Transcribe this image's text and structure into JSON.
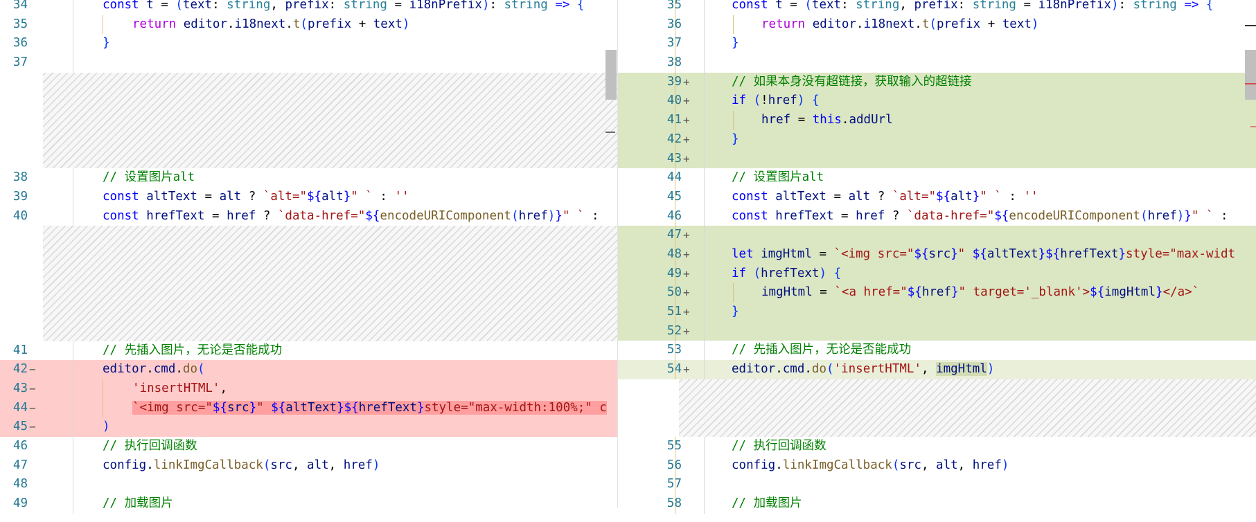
{
  "left": {
    "rows": [
      {
        "kind": "ctx",
        "ln": "34",
        "code": [
          [
            "kw",
            "const "
          ],
          [
            "v",
            "t"
          ],
          [
            "pn",
            " = "
          ],
          [
            "br",
            "("
          ],
          [
            "v",
            "text"
          ],
          [
            "pn",
            ": "
          ],
          [
            "t",
            "string"
          ],
          [
            "pn",
            ", "
          ],
          [
            "v",
            "prefix"
          ],
          [
            "pn",
            ": "
          ],
          [
            "t",
            "string"
          ],
          [
            "pn",
            " = "
          ],
          [
            "v",
            "i18nPrefix"
          ],
          [
            "br",
            ")"
          ],
          [
            "pn",
            ": "
          ],
          [
            "t",
            "string"
          ],
          [
            "pn",
            " "
          ],
          [
            "kw",
            "=>"
          ],
          [
            "pn",
            " "
          ],
          [
            "br",
            "{"
          ]
        ],
        "ind": 0
      },
      {
        "kind": "ctx",
        "ln": "35",
        "code": [
          [
            "kw2",
            "return "
          ],
          [
            "v",
            "editor"
          ],
          [
            "pn",
            "."
          ],
          [
            "v",
            "i18next"
          ],
          [
            "pn",
            "."
          ],
          [
            "fn",
            "t"
          ],
          [
            "br",
            "("
          ],
          [
            "v",
            "prefix"
          ],
          [
            "pn",
            " + "
          ],
          [
            "v",
            "text"
          ],
          [
            "br",
            ")"
          ]
        ],
        "ind": 1
      },
      {
        "kind": "ctx",
        "ln": "36",
        "code": [
          [
            "br",
            "}"
          ]
        ],
        "ind": 0
      },
      {
        "kind": "ctx",
        "ln": "37",
        "code": [],
        "ind": 0
      },
      {
        "kind": "gap",
        "style": "hatch",
        "lines": 5
      },
      {
        "kind": "ctx",
        "ln": "38",
        "code": [
          [
            "cm",
            "// 设置图片alt"
          ]
        ],
        "ind": 0
      },
      {
        "kind": "ctx",
        "ln": "39",
        "code": [
          [
            "kw",
            "const "
          ],
          [
            "v",
            "altText"
          ],
          [
            "pn",
            " = "
          ],
          [
            "v",
            "alt"
          ],
          [
            "pn",
            " ? "
          ],
          [
            "s",
            "`alt=\""
          ],
          [
            "b",
            "${"
          ],
          [
            "v",
            "alt"
          ],
          [
            "b",
            "}"
          ],
          [
            "s",
            "\" `"
          ],
          [
            "pn",
            " : "
          ],
          [
            "s",
            "''"
          ]
        ],
        "ind": 0
      },
      {
        "kind": "ctx",
        "ln": "40",
        "code": [
          [
            "kw",
            "const "
          ],
          [
            "v",
            "hrefText"
          ],
          [
            "pn",
            " = "
          ],
          [
            "v",
            "href"
          ],
          [
            "pn",
            " ? "
          ],
          [
            "s",
            "`data-href=\""
          ],
          [
            "b",
            "${"
          ],
          [
            "fn",
            "encodeURIComponent"
          ],
          [
            "br",
            "("
          ],
          [
            "v",
            "href"
          ],
          [
            "br",
            ")"
          ],
          [
            "b",
            "}"
          ],
          [
            "s",
            "\" `"
          ],
          [
            "pn",
            " :"
          ]
        ],
        "ind": 0
      },
      {
        "kind": "gap",
        "style": "hatch",
        "lines": 6
      },
      {
        "kind": "ctx",
        "ln": "41",
        "code": [
          [
            "cm",
            "// 先插入图片，无论是否能成功"
          ]
        ],
        "ind": 0
      },
      {
        "kind": "del",
        "ln": "42",
        "code": [
          [
            "v",
            "editor"
          ],
          [
            "pn",
            "."
          ],
          [
            "v",
            "cmd"
          ],
          [
            "pn",
            "."
          ],
          [
            "fn",
            "do"
          ],
          [
            "br",
            "("
          ]
        ],
        "ind": 0
      },
      {
        "kind": "del",
        "ln": "43",
        "code": [
          [
            "s",
            "'insertHTML'"
          ],
          [
            "pn",
            ","
          ]
        ],
        "ind": 1
      },
      {
        "kind": "del",
        "ln": "44",
        "code": [
          [
            "s",
            "`<img"
          ],
          [
            "mk",
            ""
          ],
          [
            "s",
            " src=\""
          ],
          [
            "b",
            "${"
          ],
          [
            "v",
            "src"
          ],
          [
            "b",
            "}"
          ],
          [
            "s",
            "\" "
          ],
          [
            "b",
            "${"
          ],
          [
            "v",
            "altText"
          ],
          [
            "b",
            "}${"
          ],
          [
            "v",
            "hrefText"
          ],
          [
            "b",
            "}"
          ],
          [
            "s",
            "style=\"max-width:100%;\" c"
          ]
        ],
        "ind": 1
      },
      {
        "kind": "del",
        "ln": "45",
        "code": [
          [
            "br",
            ")"
          ]
        ],
        "ind": 0
      },
      {
        "kind": "ctx",
        "ln": "46",
        "code": [
          [
            "cm",
            "// 执行回调函数"
          ]
        ],
        "ind": 0
      },
      {
        "kind": "ctx",
        "ln": "47",
        "code": [
          [
            "v",
            "config"
          ],
          [
            "pn",
            "."
          ],
          [
            "fn",
            "linkImgCallback"
          ],
          [
            "br",
            "("
          ],
          [
            "v",
            "src"
          ],
          [
            "pn",
            ", "
          ],
          [
            "v",
            "alt"
          ],
          [
            "pn",
            ", "
          ],
          [
            "v",
            "href"
          ],
          [
            "br",
            ")"
          ]
        ],
        "ind": 0
      },
      {
        "kind": "ctx",
        "ln": "48",
        "code": [],
        "ind": 0
      },
      {
        "kind": "ctx",
        "ln": "49",
        "code": [
          [
            "cm",
            "// 加载图片"
          ]
        ],
        "ind": 0
      }
    ]
  },
  "right": {
    "rows": [
      {
        "kind": "ctx",
        "ln": "35",
        "code": [
          [
            "kw",
            "const "
          ],
          [
            "v",
            "t"
          ],
          [
            "pn",
            " = "
          ],
          [
            "br",
            "("
          ],
          [
            "v",
            "text"
          ],
          [
            "pn",
            ": "
          ],
          [
            "t",
            "string"
          ],
          [
            "pn",
            ", "
          ],
          [
            "v",
            "prefix"
          ],
          [
            "pn",
            ": "
          ],
          [
            "t",
            "string"
          ],
          [
            "pn",
            " = "
          ],
          [
            "v",
            "i18nPrefix"
          ],
          [
            "br",
            ")"
          ],
          [
            "pn",
            ": "
          ],
          [
            "t",
            "string"
          ],
          [
            "pn",
            " "
          ],
          [
            "kw",
            "=>"
          ],
          [
            "pn",
            " "
          ],
          [
            "br",
            "{"
          ]
        ],
        "ind": 0
      },
      {
        "kind": "ctx",
        "ln": "36",
        "code": [
          [
            "kw2",
            "return "
          ],
          [
            "v",
            "editor"
          ],
          [
            "pn",
            "."
          ],
          [
            "v",
            "i18next"
          ],
          [
            "pn",
            "."
          ],
          [
            "fn",
            "t"
          ],
          [
            "br",
            "("
          ],
          [
            "v",
            "prefix"
          ],
          [
            "pn",
            " + "
          ],
          [
            "v",
            "text"
          ],
          [
            "br",
            ")"
          ]
        ],
        "ind": 1
      },
      {
        "kind": "ctx",
        "ln": "37",
        "code": [
          [
            "br",
            "}"
          ]
        ],
        "ind": 0
      },
      {
        "kind": "ctx",
        "ln": "38",
        "code": [],
        "ind": 0
      },
      {
        "kind": "add",
        "ln": "39",
        "code": [
          [
            "cm",
            "// 如果本身没有超链接，获取输入的超链接"
          ]
        ],
        "ind": 0
      },
      {
        "kind": "add",
        "ln": "40",
        "code": [
          [
            "kw",
            "if "
          ],
          [
            "br",
            "("
          ],
          [
            "pn",
            "!"
          ],
          [
            "v",
            "href"
          ],
          [
            "br",
            ")"
          ],
          [
            "pn",
            " "
          ],
          [
            "br",
            "{"
          ]
        ],
        "ind": 0
      },
      {
        "kind": "add",
        "ln": "41",
        "code": [
          [
            "v",
            "href"
          ],
          [
            "pn",
            " = "
          ],
          [
            "kw",
            "this"
          ],
          [
            "pn",
            "."
          ],
          [
            "v",
            "addUrl"
          ]
        ],
        "ind": 1
      },
      {
        "kind": "add",
        "ln": "42",
        "code": [
          [
            "br",
            "}"
          ]
        ],
        "ind": 0
      },
      {
        "kind": "add",
        "ln": "43",
        "code": [],
        "ind": 0
      },
      {
        "kind": "ctx",
        "ln": "44",
        "code": [
          [
            "cm",
            "// 设置图片alt"
          ]
        ],
        "ind": 0
      },
      {
        "kind": "ctx",
        "ln": "45",
        "code": [
          [
            "kw",
            "const "
          ],
          [
            "v",
            "altText"
          ],
          [
            "pn",
            " = "
          ],
          [
            "v",
            "alt"
          ],
          [
            "pn",
            " ? "
          ],
          [
            "s",
            "`alt=\""
          ],
          [
            "b",
            "${"
          ],
          [
            "v",
            "alt"
          ],
          [
            "b",
            "}"
          ],
          [
            "s",
            "\" `"
          ],
          [
            "pn",
            " : "
          ],
          [
            "s",
            "''"
          ]
        ],
        "ind": 0
      },
      {
        "kind": "ctx",
        "ln": "46",
        "code": [
          [
            "kw",
            "const "
          ],
          [
            "v",
            "hrefText"
          ],
          [
            "pn",
            " = "
          ],
          [
            "v",
            "href"
          ],
          [
            "pn",
            " ? "
          ],
          [
            "s",
            "`data-href=\""
          ],
          [
            "b",
            "${"
          ],
          [
            "fn",
            "encodeURIComponent"
          ],
          [
            "br",
            "("
          ],
          [
            "v",
            "href"
          ],
          [
            "br",
            ")"
          ],
          [
            "b",
            "}"
          ],
          [
            "s",
            "\" `"
          ],
          [
            "pn",
            " :"
          ]
        ],
        "ind": 0
      },
      {
        "kind": "add",
        "ln": "47",
        "code": [],
        "ind": 0
      },
      {
        "kind": "add",
        "ln": "48",
        "code": [
          [
            "kw",
            "let "
          ],
          [
            "v",
            "imgHtml"
          ],
          [
            "pn",
            " = "
          ],
          [
            "s",
            "`<img src=\""
          ],
          [
            "b",
            "${"
          ],
          [
            "v",
            "src"
          ],
          [
            "b",
            "}"
          ],
          [
            "s",
            "\" "
          ],
          [
            "b",
            "${"
          ],
          [
            "v",
            "altText"
          ],
          [
            "b",
            "}${"
          ],
          [
            "v",
            "hrefText"
          ],
          [
            "b",
            "}"
          ],
          [
            "s",
            "style=\"max-widt"
          ]
        ],
        "ind": 0
      },
      {
        "kind": "add",
        "ln": "49",
        "code": [
          [
            "kw",
            "if "
          ],
          [
            "br",
            "("
          ],
          [
            "v",
            "hrefText"
          ],
          [
            "br",
            ")"
          ],
          [
            "pn",
            " "
          ],
          [
            "br",
            "{"
          ]
        ],
        "ind": 0
      },
      {
        "kind": "add",
        "ln": "50",
        "code": [
          [
            "v",
            "imgHtml"
          ],
          [
            "pn",
            " = "
          ],
          [
            "s",
            "`<a href=\""
          ],
          [
            "b",
            "${"
          ],
          [
            "v",
            "href"
          ],
          [
            "b",
            "}"
          ],
          [
            "s",
            "\" target='_blank'>"
          ],
          [
            "b",
            "${"
          ],
          [
            "v",
            "imgHtml"
          ],
          [
            "b",
            "}"
          ],
          [
            "s",
            "</a>`"
          ]
        ],
        "ind": 1
      },
      {
        "kind": "add",
        "ln": "51",
        "code": [
          [
            "br",
            "}"
          ]
        ],
        "ind": 0
      },
      {
        "kind": "add",
        "ln": "52",
        "code": [],
        "ind": 0
      },
      {
        "kind": "ctx",
        "ln": "53",
        "code": [
          [
            "cm",
            "// 先插入图片，无论是否能成功"
          ]
        ],
        "ind": 0
      },
      {
        "kind": "addl",
        "ln": "54",
        "code": [
          [
            "v",
            "editor"
          ],
          [
            "pn",
            "."
          ],
          [
            "v",
            "cmd"
          ],
          [
            "pn",
            "."
          ],
          [
            "fn",
            "do"
          ],
          [
            "br",
            "("
          ],
          [
            "s",
            "'insertHTML'"
          ],
          [
            "pn",
            ", "
          ],
          [
            "cmk",
            "imgHtml"
          ],
          [
            "br",
            ")"
          ]
        ],
        "ind": 0
      },
      {
        "kind": "gap",
        "style": "hatch",
        "lines": 3
      },
      {
        "kind": "ctx",
        "ln": "55",
        "code": [
          [
            "cm",
            "// 执行回调函数"
          ]
        ],
        "ind": 0
      },
      {
        "kind": "ctx",
        "ln": "56",
        "code": [
          [
            "v",
            "config"
          ],
          [
            "pn",
            "."
          ],
          [
            "fn",
            "linkImgCallback"
          ],
          [
            "br",
            "("
          ],
          [
            "v",
            "src"
          ],
          [
            "pn",
            ", "
          ],
          [
            "v",
            "alt"
          ],
          [
            "pn",
            ", "
          ],
          [
            "v",
            "href"
          ],
          [
            "br",
            ")"
          ]
        ],
        "ind": 0
      },
      {
        "kind": "ctx",
        "ln": "57",
        "code": [],
        "ind": 0
      },
      {
        "kind": "ctx",
        "ln": "58",
        "code": [
          [
            "cm",
            "// 加载图片"
          ]
        ],
        "ind": 0
      }
    ]
  },
  "markers": {
    "del": "−",
    "add": "+"
  },
  "colors": {
    "deleted": "#ffcccc",
    "inserted": "#dbe6c2",
    "line_number": "#237893"
  }
}
